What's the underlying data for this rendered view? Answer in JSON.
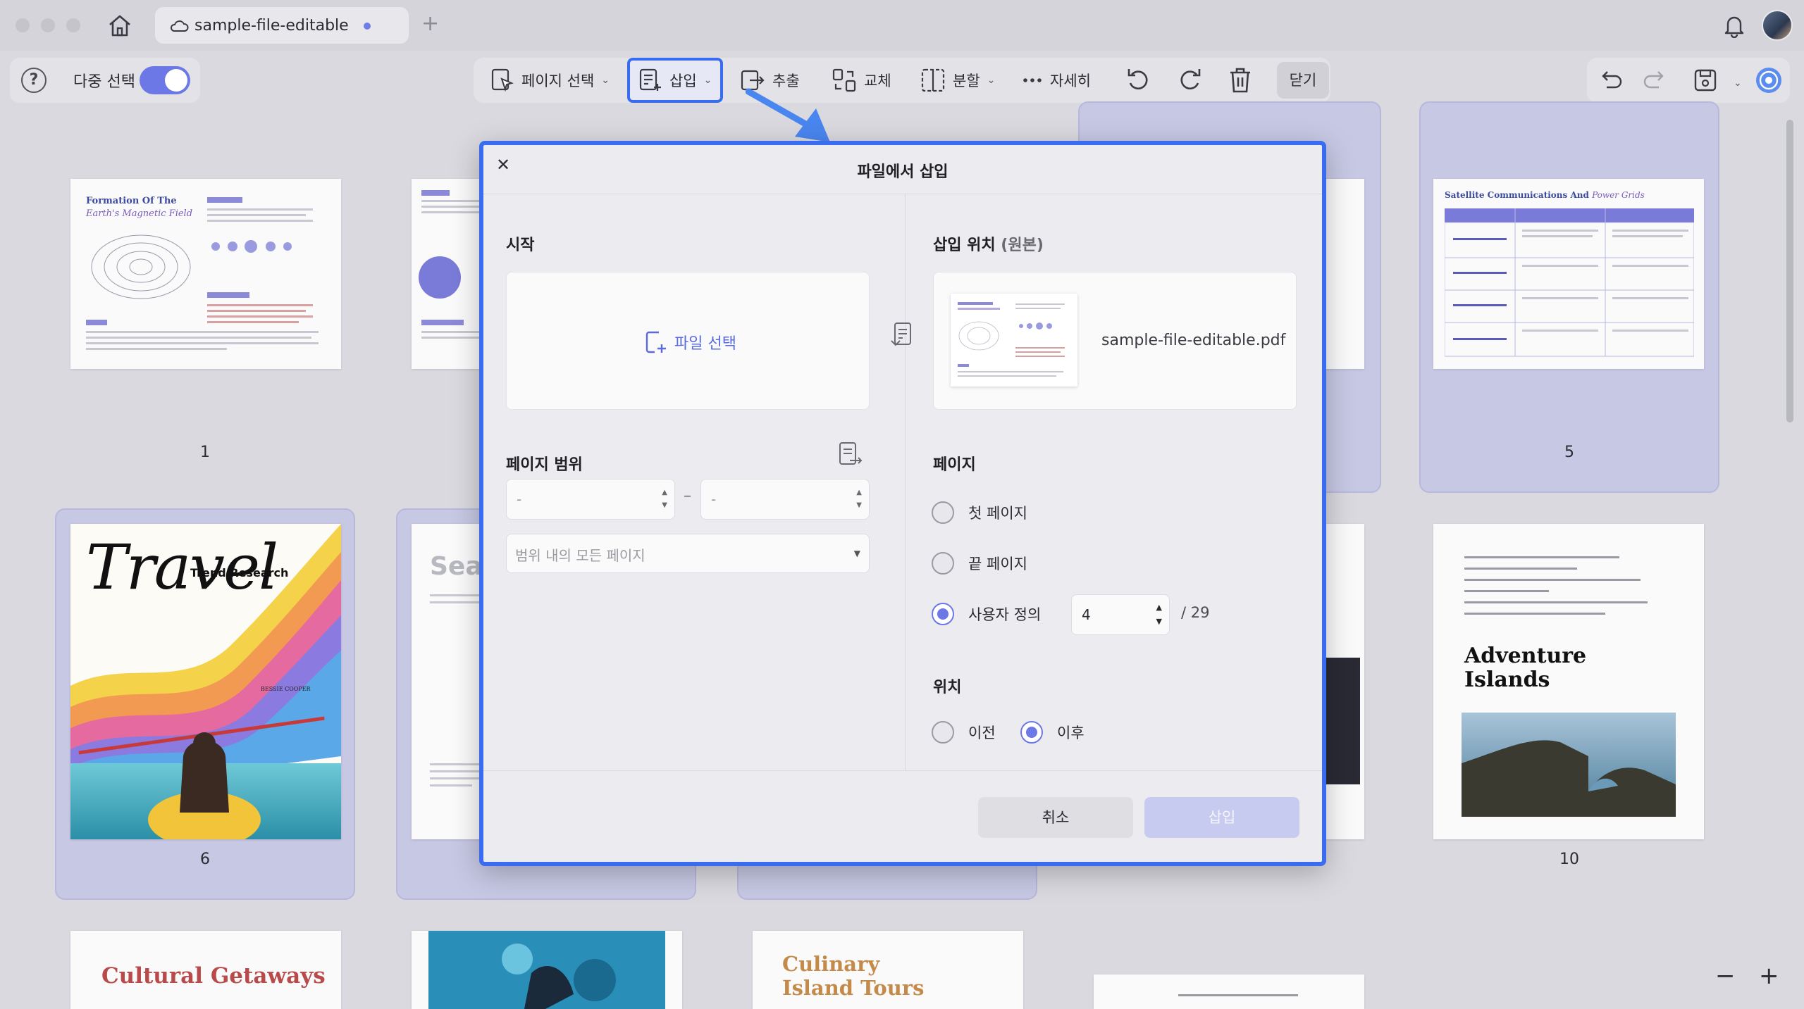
{
  "window": {
    "tab_title": "sample-file-editable",
    "add_tab": "+"
  },
  "toolbar": {
    "help": "?",
    "multi_select_label": "다중 선택",
    "multi_select_on": true,
    "page_select": "페이지 선택",
    "insert": "삽입",
    "extract": "추출",
    "replace": "교체",
    "split": "분할",
    "more": "자세히",
    "close": "닫기"
  },
  "pages": [
    {
      "number": "1",
      "title_line1": "Formation Of The",
      "title_line2": "Earth's Magnetic Field"
    },
    {
      "number": "5",
      "title_line1": "Satellite Communications And",
      "title_line2": "Power Grids"
    },
    {
      "number": "6",
      "title_line1": "Travel",
      "subtitle": "Trend Research",
      "author": "BESSIE COOPER"
    },
    {
      "number": "10",
      "title_line1": "Adventure",
      "title_line2": "Islands"
    },
    {
      "number": "",
      "title_line1": "Cultural Getaways"
    },
    {
      "number": "",
      "title_line1": "Culinary",
      "title_line2": "Island Tours"
    }
  ],
  "partial_page_text": "Sea",
  "dialog": {
    "title": "파일에서 삽입",
    "close": "✕",
    "start_label": "시작",
    "file_select": "파일 선택",
    "page_range_label": "페이지 범위",
    "range_from_placeholder": "-",
    "range_to_placeholder": "-",
    "range_dash": "–",
    "range_option": "범위 내의 모든 페이지",
    "insert_position_label": "삽입 위치",
    "insert_position_suffix": "(원본)",
    "target_file": "sample-file-editable.pdf",
    "page_label": "페이지",
    "first_page": "첫 페이지",
    "last_page": "끝 페이지",
    "custom": "사용자 정의",
    "custom_selected": true,
    "custom_page_value": "4",
    "total_pages": "/ 29",
    "position_label": "위치",
    "before": "이전",
    "after": "이후",
    "after_selected": true,
    "cancel": "취소",
    "insert_button": "삽입"
  },
  "zoom": {
    "minus": "−",
    "plus": "+"
  },
  "colors": {
    "accent": "#6b78e6",
    "highlight": "#3a6cf0",
    "selected_card": "#c7c8e4"
  }
}
